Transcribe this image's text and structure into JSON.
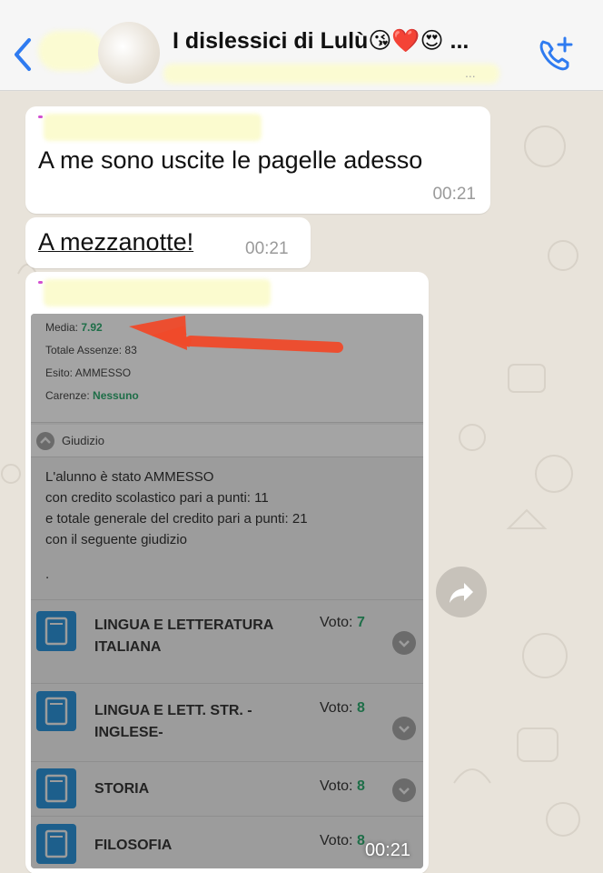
{
  "header": {
    "title": "I dislessici di Lulù😘❤️😍 ...",
    "subtitle_ellipsis": "...",
    "back_icon": "chevron-left-icon",
    "call_icon": "add-call-icon",
    "accent_color": "#2f7bf0"
  },
  "messages": [
    {
      "text": "A me sono uscite le pagelle adesso",
      "time": "00:21"
    },
    {
      "text": "A mezzanotte!",
      "time": "00:21"
    }
  ],
  "report_image": {
    "summary": {
      "media_label": "Media:",
      "media_value": "7.92",
      "assenze_label": "Totale Assenze:",
      "assenze_value": "83",
      "esito_label": "Esito:",
      "esito_value": "AMMESSO",
      "carenze_label": "Carenze:",
      "carenze_value": "Nessuno"
    },
    "giudizio_header": "Giudizio",
    "giudizio_lines": [
      "L'alunno è stato AMMESSO",
      "con credito scolastico pari a punti: 11",
      "e totale generale del credito pari a punti: 21",
      "con il seguente giudizio"
    ],
    "giudizio_dot": ".",
    "voto_label": "Voto:",
    "subjects": [
      {
        "name_line1": "LINGUA E LETTERATURA",
        "name_line2": "ITALIANA",
        "voto": "7"
      },
      {
        "name_line1": "LINGUA E LETT. STR. -",
        "name_line2": "INGLESE-",
        "voto": "8"
      },
      {
        "name_line1": "STORIA",
        "name_line2": "",
        "voto": "8"
      },
      {
        "name_line1": "FILOSOFIA",
        "name_line2": "",
        "voto": "8"
      }
    ],
    "time": "00:21",
    "annotation": "red-arrow-pointing-to-media"
  },
  "forward_icon": "forward-arrow-icon"
}
